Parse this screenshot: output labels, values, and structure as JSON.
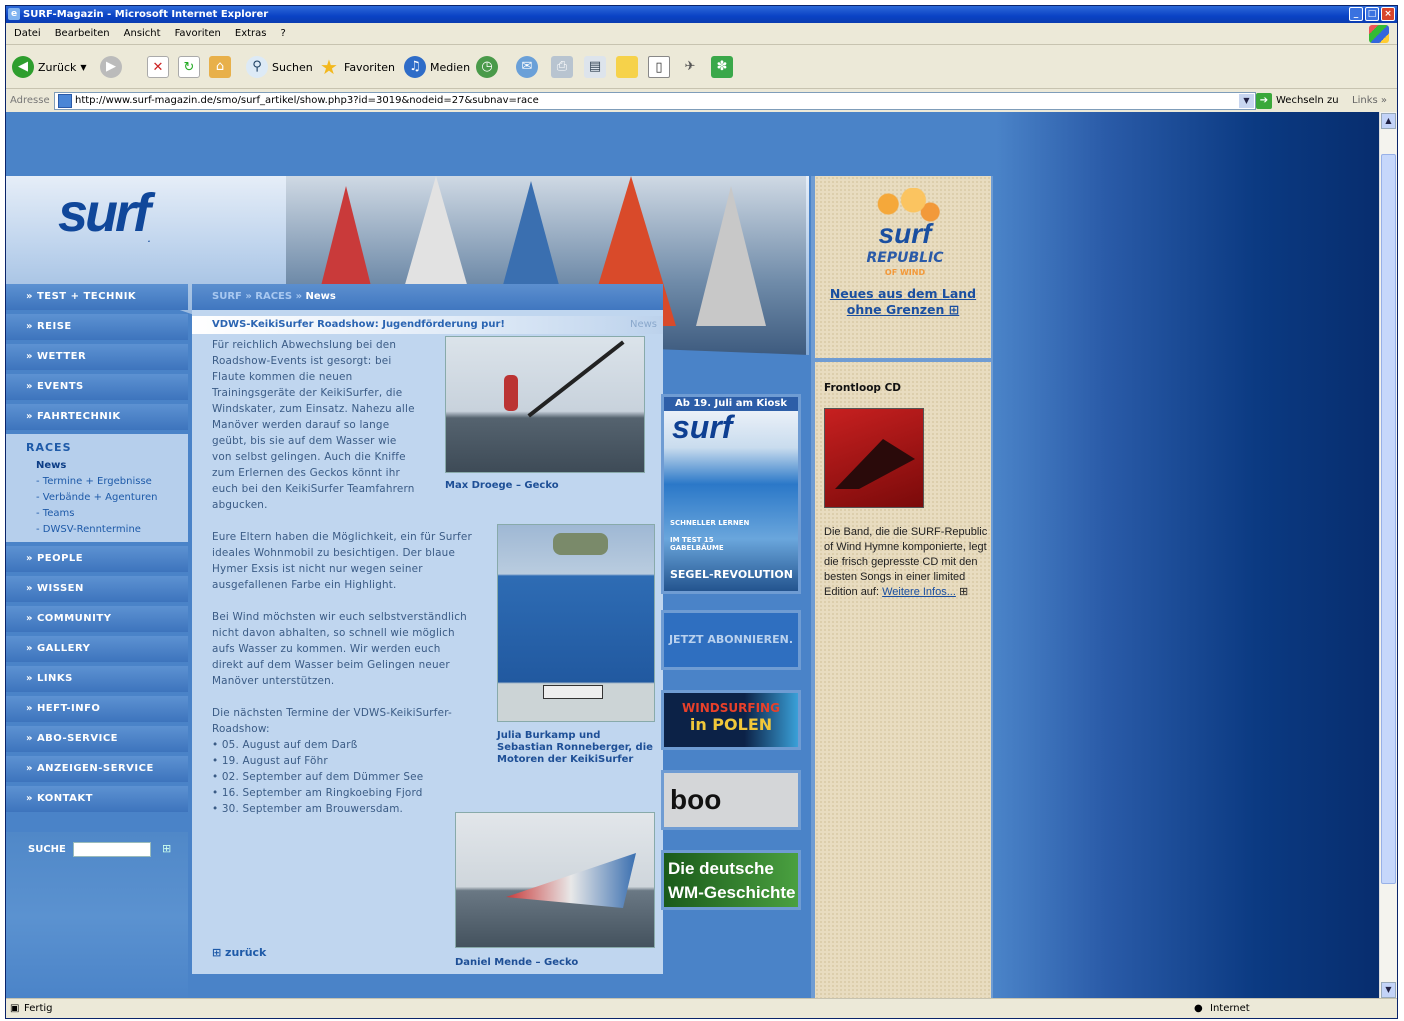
{
  "window": {
    "title": "SURF-Magazin - Microsoft Internet Explorer"
  },
  "menu": [
    "Datei",
    "Bearbeiten",
    "Ansicht",
    "Favoriten",
    "Extras",
    "?"
  ],
  "toolbar": {
    "back": "Zurück",
    "search": "Suchen",
    "favorites": "Favoriten",
    "media": "Medien"
  },
  "address": {
    "label": "Adresse",
    "url": "http://www.surf-magazin.de/smo/surf_artikel/show.php3?id=3019&nodeid=27&subnav=race",
    "go": "Wechseln zu",
    "links": "Links"
  },
  "status": {
    "left": "Fertig",
    "zone": "Internet"
  },
  "nav": {
    "items_top": [
      "» TEST + TECHNIK",
      "» REISE",
      "» WETTER",
      "» EVENTS",
      "» FAHRTECHNIK"
    ],
    "races_title": "RACES",
    "races_sub": [
      "News",
      "- Termine + Ergebnisse",
      "- Verbände + Agenturen",
      "- Teams",
      "- DWSV-Renntermine"
    ],
    "items_bottom": [
      "» PEOPLE",
      "» WISSEN",
      "» COMMUNITY",
      "» GALLERY",
      "» LINKS",
      "» HEFT-INFO",
      "» ABO-SERVICE",
      "» ANZEIGEN-SERVICE",
      "» KONTAKT"
    ],
    "search_label": "SUCHE"
  },
  "logo": "surf",
  "breadcrumb": {
    "path": "SURF » RACES » ",
    "current": "News"
  },
  "article": {
    "title": "VDWS-KeikiSurfer Roadshow: Jugendförderung pur!",
    "section": "News",
    "p1": [
      "Für reichlich Abwechslung bei den",
      "Roadshow-Events ist gesorgt: bei",
      "Flaute kommen die neuen",
      "Trainingsgeräte der KeikiSurfer, die",
      "Windskater, zum Einsatz. Nahezu alle",
      "Manöver werden darauf so lange",
      "geübt, bis sie auf dem Wasser wie",
      "von selbst gelingen. Auch die Kniffe",
      "zum Erlernen des Geckos könnt ihr",
      "euch bei den KeikiSurfer Teamfahrern",
      "abgucken."
    ],
    "p2": [
      "Eure Eltern haben die Möglichkeit, ein für Surfer",
      "ideales Wohnmobil zu besichtigen. Der blaue",
      "Hymer Exsis ist nicht nur wegen seiner",
      "ausgefallenen Farbe ein Highlight."
    ],
    "p3": [
      "Bei Wind möchsten wir euch selbstverständlich",
      "nicht davon abhalten, so schnell wie möglich",
      "aufs Wasser zu kommen. Wir werden euch",
      "direkt auf dem Wasser beim Gelingen neuer",
      "Manöver unterstützen."
    ],
    "p4": [
      "Die nächsten Termine der VDWS-KeikiSurfer-",
      "Roadshow:",
      "• 05. August auf dem Darß",
      "• 19. August auf Föhr",
      "• 02. September auf dem Dümmer See",
      "• 16. September am Ringkoebing Fjord",
      "• 30. September am Brouwersdam."
    ],
    "caption1": "Max Droege – Gecko",
    "caption2": [
      "Julia Burkamp und",
      "Sebastian Ronneberger, die",
      "Motoren der KeikiSurfer"
    ],
    "caption3": "Daniel Mende – Gecko",
    "back": "⊞ zurück"
  },
  "ads": {
    "kiosk": "Ab 19. Juli am Kiosk",
    "cover_lines": [
      "SCHNELLER LERNEN",
      "IM TEST 15 GABELBÄUME",
      "SEGEL-REVOLUTION"
    ],
    "abo": "JETZT ABONNIEREN.",
    "polen": [
      "WINDSURFING",
      "in POLEN"
    ],
    "boo": "boo",
    "wm": [
      "Die deutsche",
      "WM-Geschichte"
    ]
  },
  "right": {
    "republic": [
      "surf",
      "REPUBLIC",
      "OF WIND"
    ],
    "republic_link": [
      "Neues aus dem Land",
      "ohne Grenzen ⊞"
    ],
    "cd_title": "Frontloop CD",
    "cd_text": "Die Band, die die SURF-Republic of Wind Hymne komponierte, legt die frisch gepresste CD mit den besten Songs in einer limited Edition auf:",
    "cd_link": "Weitere Infos..."
  }
}
